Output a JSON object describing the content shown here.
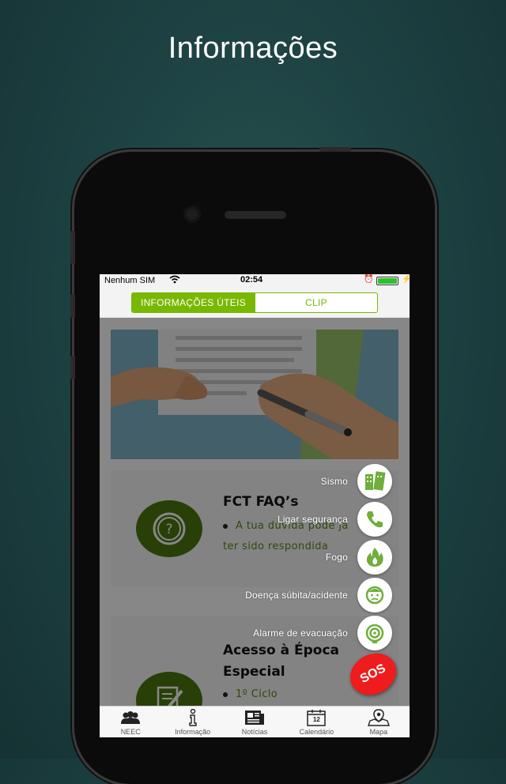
{
  "heading": "Informações",
  "status": {
    "carrier": "Nenhum SIM",
    "time": "02:54"
  },
  "segments": [
    {
      "label": "INFORMAÇÕES ÚTEIS",
      "active": true
    },
    {
      "label": "CLIP",
      "active": false
    }
  ],
  "cards": [
    {
      "title": "FCT FAQ’s",
      "bullet": "A tua dúvida pode já",
      "line2": "ter sido respondida",
      "icon": "question-icon"
    },
    {
      "title": "Acesso à Época",
      "title2": "Especial",
      "bullet": "1º Ciclo",
      "icon": "pencil-paper-icon"
    }
  ],
  "emergency_menu": [
    {
      "label": "Sismo",
      "icon": "building-collapse-icon"
    },
    {
      "label": "Ligar segurança",
      "icon": "phone-icon"
    },
    {
      "label": "Fogo",
      "icon": "fire-icon"
    },
    {
      "label": "Doença súbita/acidente",
      "icon": "sick-person-icon"
    },
    {
      "label": "Alarme de evacuação",
      "icon": "alarm-icon"
    }
  ],
  "sos_label": "SOS",
  "tabs": [
    {
      "label": "NEEC",
      "icon": "group-icon"
    },
    {
      "label": "Informação",
      "icon": "info-icon"
    },
    {
      "label": "Notícias",
      "icon": "newspaper-icon"
    },
    {
      "label": "Calendário",
      "icon": "calendar-icon",
      "day": "12"
    },
    {
      "label": "Mapa",
      "icon": "map-pin-icon"
    }
  ],
  "colors": {
    "accent": "#79b800",
    "card_icon": "#4c7a10",
    "sos": "#ee1c1c",
    "menu_icon": "#6fae3b"
  }
}
